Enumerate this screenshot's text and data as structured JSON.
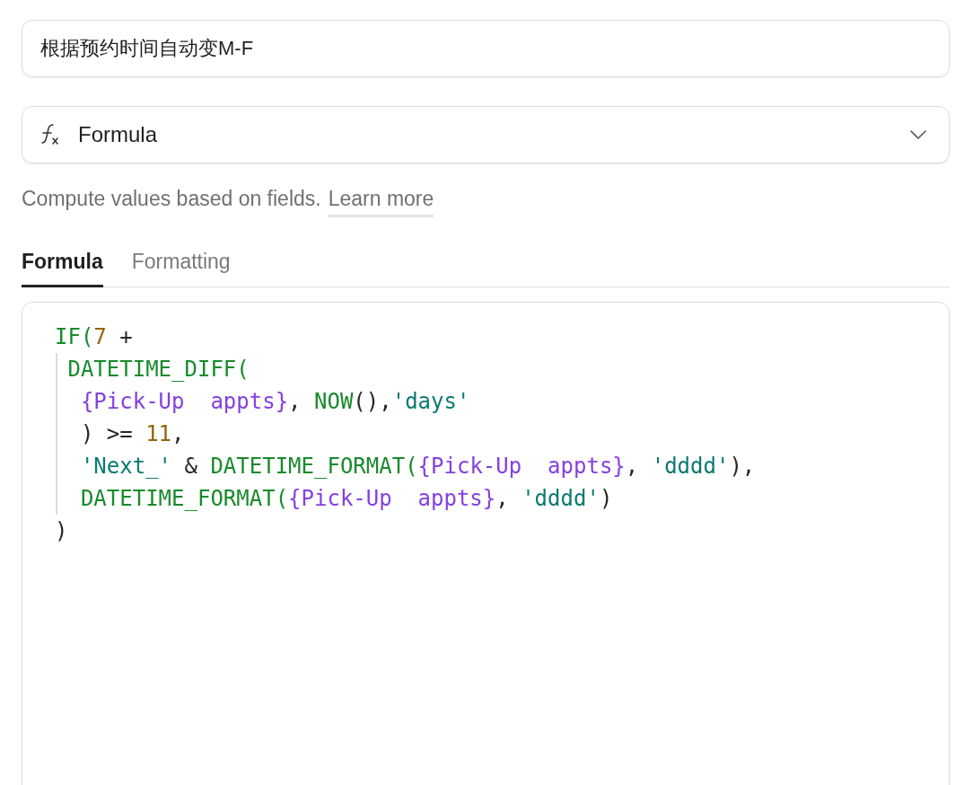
{
  "field_name": {
    "value": "根据预约时间自动变M-F"
  },
  "field_type": {
    "label": "Formula"
  },
  "help": {
    "text": "Compute values based on fields.",
    "link": "Learn more"
  },
  "tabs": [
    {
      "label": "Formula",
      "selected": true
    },
    {
      "label": "Formatting",
      "selected": false
    }
  ],
  "editor": {
    "lines": [
      {
        "tokens": [
          {
            "kind": "func",
            "text": "IF("
          },
          {
            "kind": "num",
            "text": "7"
          },
          {
            "kind": "plain",
            "text": " +"
          }
        ],
        "children": [
          {
            "tokens": [
              {
                "kind": "func",
                "text": "DATETIME_DIFF("
              }
            ],
            "children": [
              {
                "tokens": [
                  {
                    "kind": "field",
                    "text": "{Pick-Up  appts}"
                  },
                  {
                    "kind": "plain",
                    "text": ", "
                  },
                  {
                    "kind": "func",
                    "text": "NOW"
                  },
                  {
                    "kind": "plain",
                    "text": "(),"
                  },
                  {
                    "kind": "str",
                    "text": "'days'"
                  }
                ]
              },
              {
                "tokens": [
                  {
                    "kind": "plain",
                    "text": ") >= "
                  },
                  {
                    "kind": "num",
                    "text": "11"
                  },
                  {
                    "kind": "plain",
                    "text": ","
                  }
                ]
              },
              {
                "tokens": [
                  {
                    "kind": "str",
                    "text": "'Next_'"
                  },
                  {
                    "kind": "plain",
                    "text": " & "
                  },
                  {
                    "kind": "func",
                    "text": "DATETIME_FORMAT("
                  },
                  {
                    "kind": "field",
                    "text": "{Pick-Up  appts}"
                  },
                  {
                    "kind": "plain",
                    "text": ", "
                  },
                  {
                    "kind": "str",
                    "text": "'dddd'"
                  },
                  {
                    "kind": "plain",
                    "text": "),"
                  }
                ]
              },
              {
                "tokens": [
                  {
                    "kind": "func",
                    "text": "DATETIME_FORMAT("
                  },
                  {
                    "kind": "field",
                    "text": "{Pick-Up  appts}"
                  },
                  {
                    "kind": "plain",
                    "text": ", "
                  },
                  {
                    "kind": "str",
                    "text": "'dddd'"
                  },
                  {
                    "kind": "plain",
                    "text": ")"
                  }
                ]
              }
            ]
          }
        ]
      },
      {
        "tokens": [
          {
            "kind": "plain",
            "text": ")"
          }
        ]
      }
    ]
  }
}
